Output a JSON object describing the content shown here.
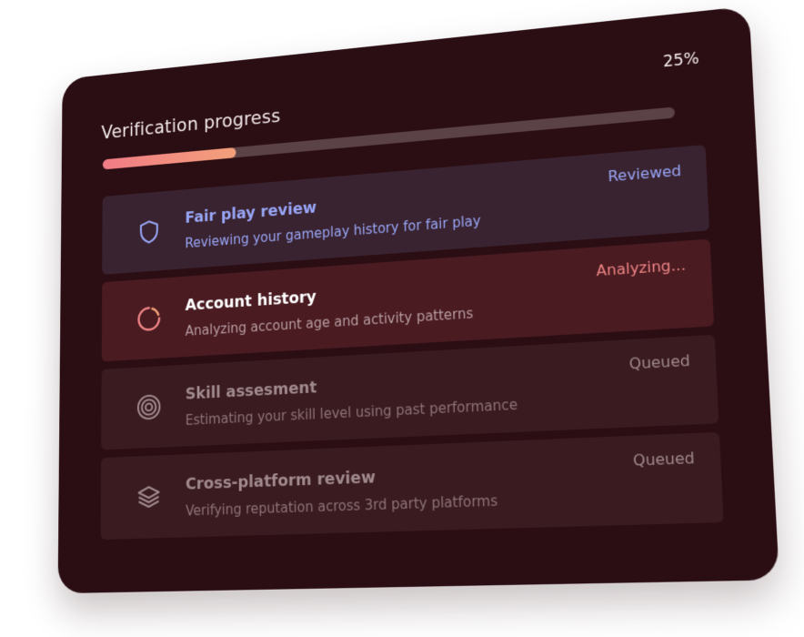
{
  "progress": {
    "title": "Verification progress",
    "percent_label": "25%",
    "value": 0.25,
    "colors": {
      "fill_start": "#f07b85",
      "fill_end": "#f3a07a",
      "track": "#5b4247"
    }
  },
  "steps": [
    {
      "title": "Fair play review",
      "subtitle": "Reviewing your gameplay history for fair play",
      "status": "Reviewed",
      "icon": "shield-icon",
      "state": "reviewed",
      "color": "#98a6f7"
    },
    {
      "title": "Account history",
      "subtitle": "Analyzing account age and activity patterns",
      "status": "Analyzing...",
      "icon": "spinner-icon",
      "state": "analyzing",
      "color": "#ef8585"
    },
    {
      "title": "Skill assesment",
      "subtitle": "Estimating your skill level using past performance",
      "status": "Queued",
      "icon": "target-icon",
      "state": "queued",
      "color": "#a08a8e"
    },
    {
      "title": "Cross-platform review",
      "subtitle": "Verifying reputation across 3rd party platforms",
      "status": "Queued",
      "icon": "layers-icon",
      "state": "queued",
      "color": "#a08a8e"
    }
  ]
}
